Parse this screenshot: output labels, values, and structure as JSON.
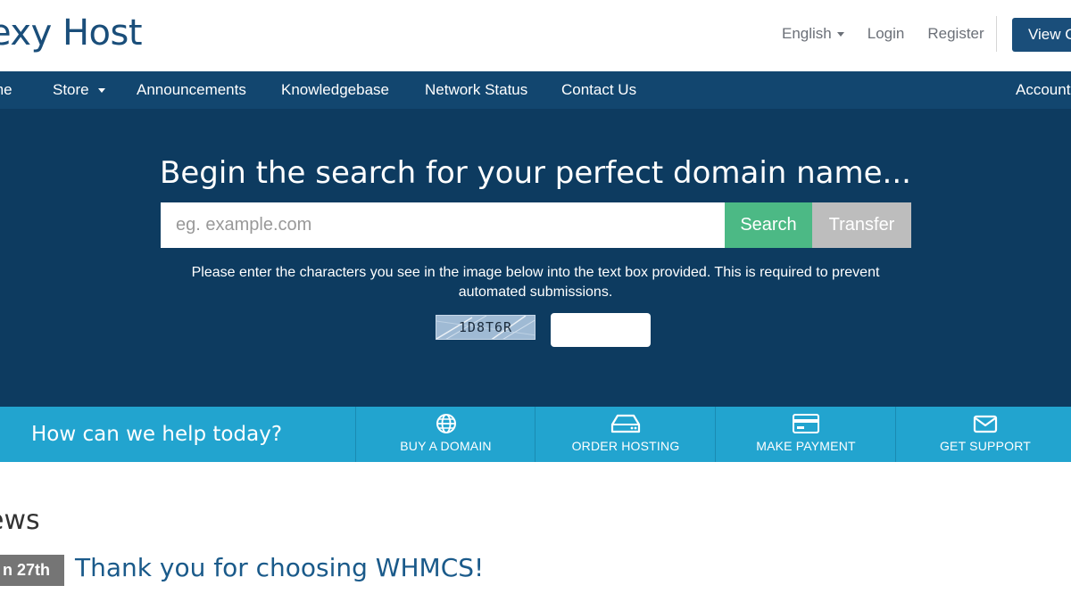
{
  "header": {
    "logo_text": "exy Host",
    "language": "English",
    "login": "Login",
    "register": "Register",
    "view_cart": "View C"
  },
  "nav": {
    "items": [
      {
        "label": "me"
      },
      {
        "label": "Store"
      },
      {
        "label": "Announcements"
      },
      {
        "label": "Knowledgebase"
      },
      {
        "label": "Network Status"
      },
      {
        "label": "Contact Us"
      },
      {
        "label": "Account"
      }
    ]
  },
  "hero": {
    "title": "Begin the search for your perfect domain name...",
    "search_placeholder": "eg. example.com",
    "search_button": "Search",
    "transfer_button": "Transfer",
    "captcha_instructions": "Please enter the characters you see in the image below into the text box provided. This is required to prevent automated submissions.",
    "captcha_code": "1D8T6R",
    "captcha_input_value": ""
  },
  "help": {
    "title": "How can we help today?",
    "items": [
      {
        "label": "BUY A DOMAIN",
        "icon": "globe-icon"
      },
      {
        "label": "ORDER HOSTING",
        "icon": "server-icon"
      },
      {
        "label": "MAKE PAYMENT",
        "icon": "credit-card-icon"
      },
      {
        "label": "GET SUPPORT",
        "icon": "envelope-icon"
      }
    ]
  },
  "news": {
    "heading": "ews",
    "date": "n 27th",
    "title": "Thank you for choosing WHMCS!"
  },
  "colors": {
    "brand": "#1a4e7a",
    "nav_bg": "#12466f",
    "hero_bg": "#0d3b60",
    "search_green": "#4cb985",
    "transfer_gray": "#bdbdbd",
    "help_bar": "#22a4cf"
  }
}
